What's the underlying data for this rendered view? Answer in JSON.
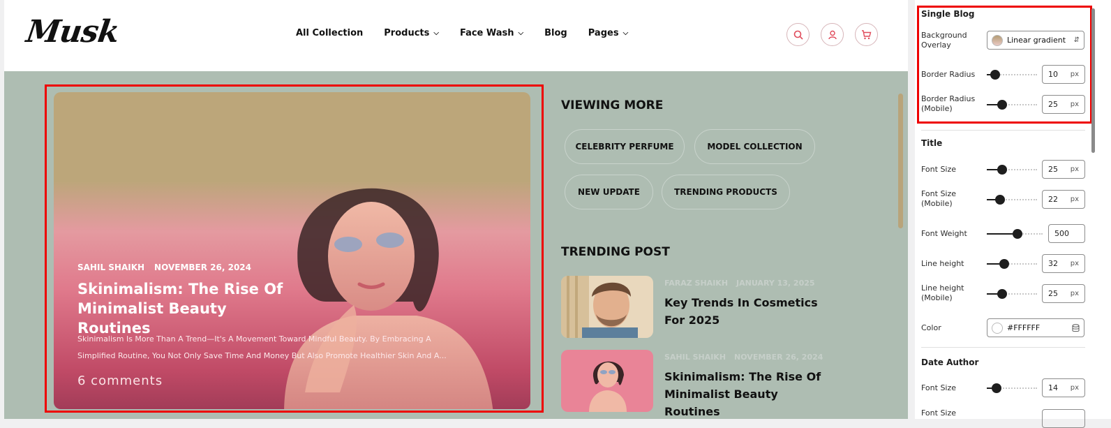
{
  "header": {
    "logo": "Musk",
    "nav": [
      {
        "label": "All Collection",
        "dropdown": false
      },
      {
        "label": "Products",
        "dropdown": true
      },
      {
        "label": "Face Wash",
        "dropdown": true
      },
      {
        "label": "Blog",
        "dropdown": false
      },
      {
        "label": "Pages",
        "dropdown": true
      }
    ],
    "icons": [
      "search-icon",
      "user-icon",
      "cart-icon"
    ],
    "accent_color": "#E04A5A"
  },
  "featured": {
    "author": "SAHIL SHAIKH",
    "date": "NOVEMBER 26, 2024",
    "title": "Skinimalism: The Rise Of Minimalist Beauty Routines",
    "excerpt": "Skinimalism Is More Than A Trend—It's A Movement Toward Mindful Beauty. By Embracing A Simplified Routine, You Not Only Save Time And Money But Also Promote Healthier Skin And A...",
    "comments": "6 comments"
  },
  "viewing_more": {
    "title": "VIEWING MORE",
    "tags": [
      "CELEBRITY PERFUME",
      "MODEL COLLECTION",
      "NEW UPDATE",
      "TRENDING PRODUCTS"
    ]
  },
  "trending": {
    "title": "TRENDING POST",
    "posts": [
      {
        "author": "FARAZ SHAIKH",
        "date": "JANUARY 13, 2025",
        "title": "Key Trends In Cosmetics For 2025"
      },
      {
        "author": "SAHIL SHAIKH",
        "date": "NOVEMBER 26, 2024",
        "title": "Skinimalism: The Rise Of Minimalist Beauty Routines"
      }
    ]
  },
  "panel": {
    "single_blog": {
      "title": "Single Blog",
      "background_overlay": {
        "label": "Background Overlay",
        "value": "Linear gradient"
      },
      "border_radius": {
        "label": "Border Radius",
        "value": "10",
        "unit": "px",
        "level": 0.17
      },
      "border_radius_mobile": {
        "label": "Border Radius (Mobile)",
        "value": "25",
        "unit": "px",
        "level": 0.3
      }
    },
    "title_group": {
      "title": "Title",
      "font_size": {
        "label": "Font Size",
        "value": "25",
        "unit": "px",
        "level": 0.3
      },
      "font_size_mobile": {
        "label": "Font Size (Mobile)",
        "value": "22",
        "unit": "px",
        "level": 0.27
      },
      "font_weight": {
        "label": "Font Weight",
        "value": "500",
        "level": 0.55
      },
      "line_height": {
        "label": "Line height",
        "value": "32",
        "unit": "px",
        "level": 0.35
      },
      "line_height_mobile": {
        "label": "Line height (Mobile)",
        "value": "25",
        "unit": "px",
        "level": 0.3
      },
      "color": {
        "label": "Color",
        "value": "#FFFFFF"
      }
    },
    "date_author": {
      "title": "Date Author",
      "font_size": {
        "label": "Font Size",
        "value": "14",
        "unit": "px",
        "level": 0.2
      },
      "font_size_mobile_partial": "Font Size"
    }
  }
}
